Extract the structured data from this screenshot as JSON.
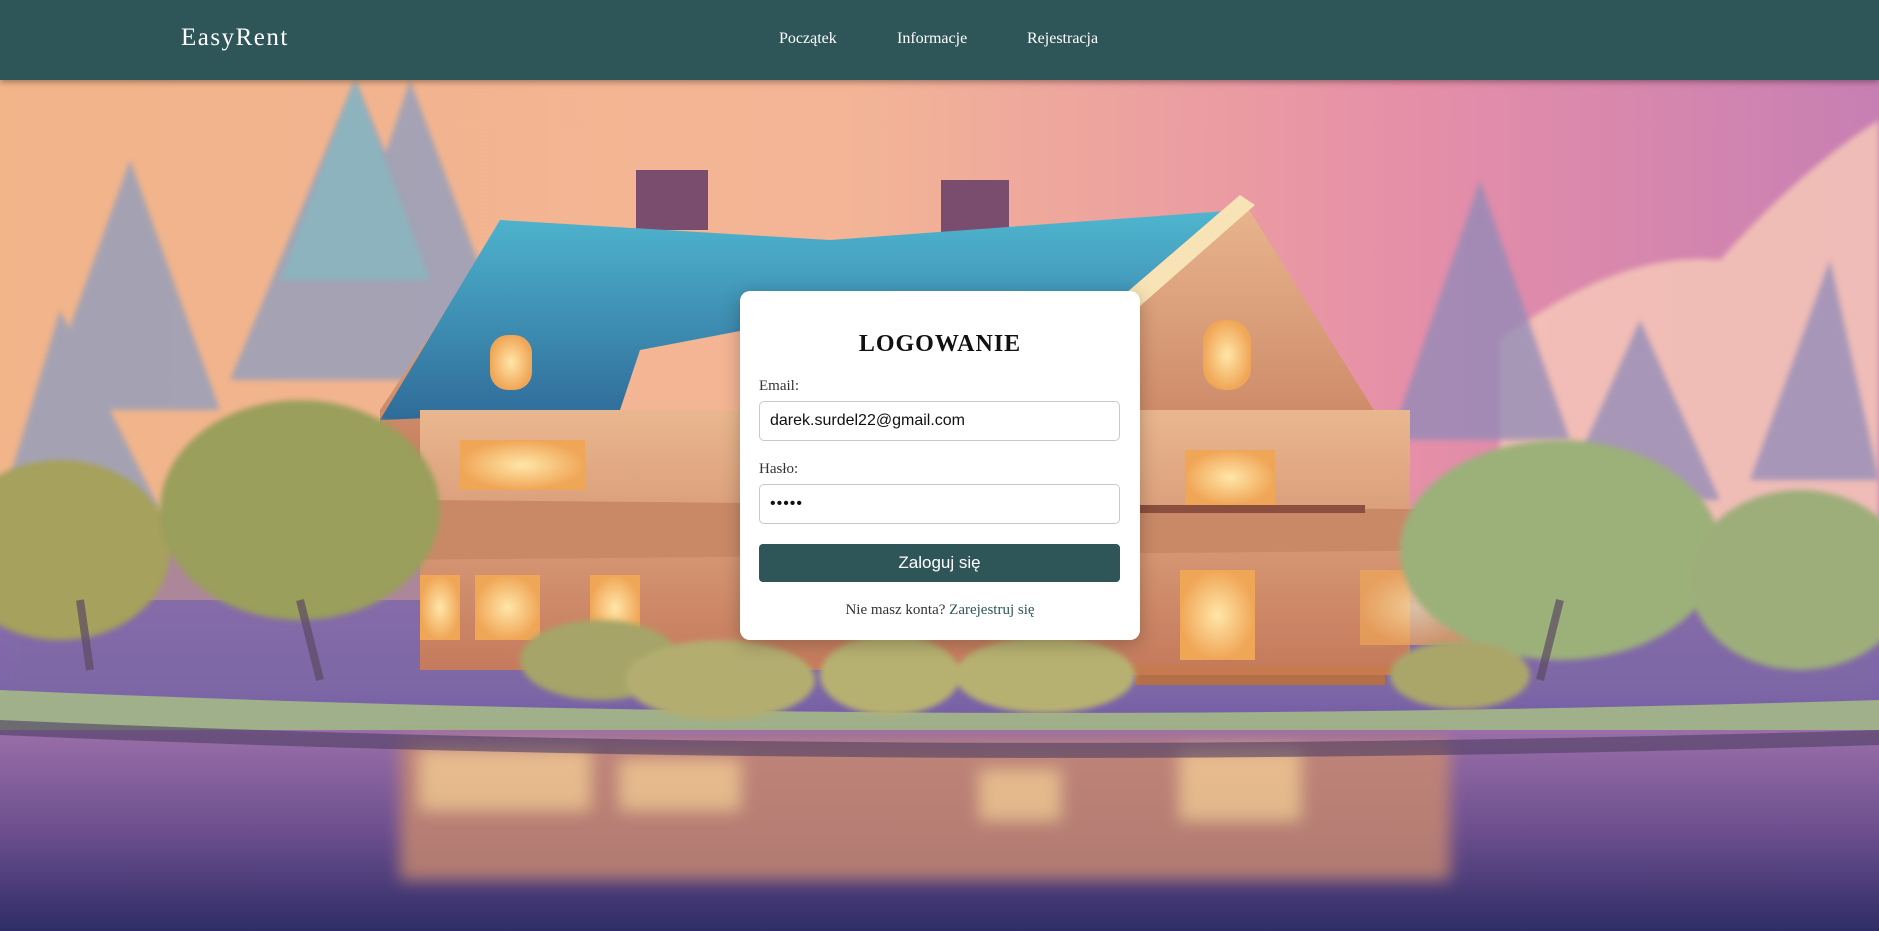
{
  "navbar": {
    "brand": "EasyRent",
    "links": [
      {
        "label": "Początek"
      },
      {
        "label": "Informacje"
      },
      {
        "label": "Rejestracja"
      }
    ]
  },
  "login": {
    "title": "LOGOWANIE",
    "email_label": "Email:",
    "email_value": "darek.surdel22@gmail.com",
    "password_label": "Hasło:",
    "password_value": "12345",
    "submit_label": "Zaloguj się",
    "no_account_text": "Nie masz konta?",
    "register_link": "Zarejestruj się"
  },
  "colors": {
    "primary": "#2e5558",
    "card_background": "#ffffff",
    "link": "#2e5558"
  },
  "background": {
    "icon": "house-landscape-illustration"
  }
}
